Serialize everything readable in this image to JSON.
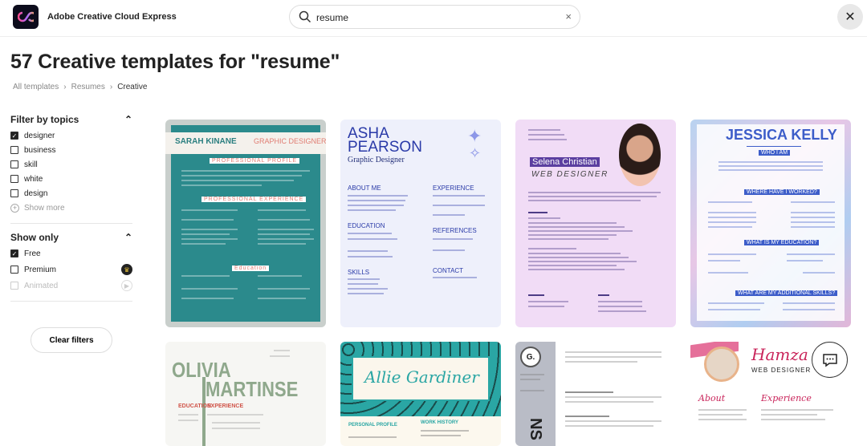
{
  "header": {
    "brand": "Adobe Creative Cloud Express",
    "search_value": "resume"
  },
  "page": {
    "title": "57 Creative templates for \"resume\"",
    "breadcrumb": [
      "All templates",
      "Resumes",
      "Creative"
    ]
  },
  "filters": {
    "topics_title": "Filter by topics",
    "topics": [
      {
        "label": "designer",
        "checked": true
      },
      {
        "label": "business",
        "checked": false
      },
      {
        "label": "skill",
        "checked": false
      },
      {
        "label": "white",
        "checked": false
      },
      {
        "label": "design",
        "checked": false
      }
    ],
    "show_more": "Show more",
    "show_only_title": "Show only",
    "show_only": [
      {
        "label": "Free",
        "checked": true
      },
      {
        "label": "Premium",
        "checked": false
      },
      {
        "label": "Animated",
        "checked": false,
        "disabled": true
      }
    ],
    "clear": "Clear filters"
  },
  "templates": [
    {
      "name": "SARAH KINANE",
      "role": "GRAPHIC DESIGNER",
      "s1": "PROFESSIONAL PROFILE",
      "s2": "PROFESSIONAL EXPERIENCE",
      "s3": "Education"
    },
    {
      "name1": "ASHA",
      "name2": "PEARSON",
      "role": "Graphic Designer",
      "s1": "ABOUT ME",
      "s2": "EDUCATION",
      "s3": "SKILLS",
      "s4": "EXPERIENCE",
      "s5": "REFERENCES",
      "s6": "CONTACT"
    },
    {
      "name": "Selena Christian",
      "role": "WEB DESIGNER"
    },
    {
      "name": "JESSICA KELLY",
      "s1": "WHO I AM",
      "s2": "WHERE HAVE I WORKED?",
      "s3": "WHAT IS MY EDUCATION?",
      "s4": "WHAT ARE MY ADDITIONAL SKILLS?"
    },
    {
      "name1": "OLIVIA",
      "name2": "MARTINSE",
      "s1": "EDUCATION",
      "s2": "EXPERIENCE"
    },
    {
      "name": "Allie Gardiner",
      "s1": "PERSONAL PROFILE",
      "s2": "WORK HISTORY"
    },
    {
      "initial": "G.",
      "side": "NS"
    },
    {
      "name": "Hamza P",
      "role": "WEB DESIGNER",
      "s1": "About",
      "s2": "Experience"
    }
  ]
}
